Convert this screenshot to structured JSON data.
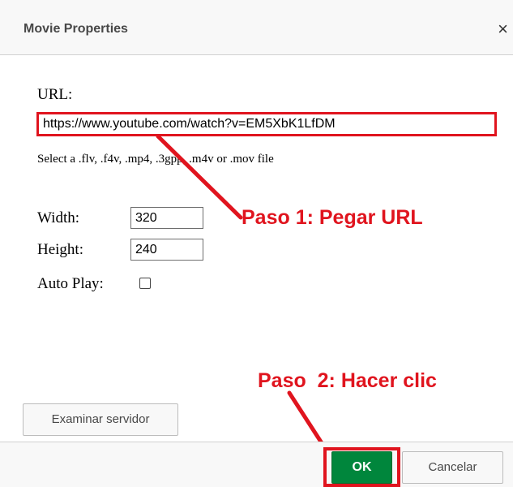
{
  "dialog": {
    "title": "Movie Properties",
    "close_symbol": "×",
    "close_icon": "close-icon"
  },
  "form": {
    "url_label": "URL:",
    "url_value": "https://www.youtube.com/watch?v=EM5XbK1LfDM",
    "hint": "Select a .flv, .f4v, .mp4, .3gpp, .m4v or .mov file",
    "width_label": "Width:",
    "width_value": "320",
    "height_label": "Height:",
    "height_value": "240",
    "autoplay_label": "Auto Play:",
    "autoplay_checked": false
  },
  "annotations": {
    "step1": "Paso 1: Pegar URL",
    "step2": "Paso  2: Hacer clic",
    "color": "#e0141e"
  },
  "buttons": {
    "browse": "Examinar servidor",
    "ok": "OK",
    "cancel": "Cancelar",
    "ok_color": "#00863c"
  }
}
